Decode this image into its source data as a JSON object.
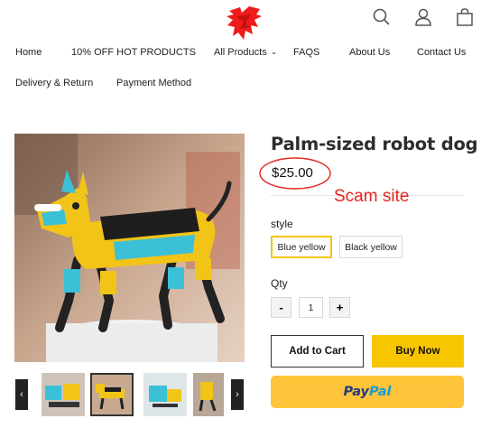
{
  "header": {
    "icons": [
      "search-icon",
      "user-icon",
      "shopping-bag-icon"
    ]
  },
  "nav": {
    "items": [
      {
        "label": "Home"
      },
      {
        "label": "10% OFF HOT PRODUCTS"
      },
      {
        "label": "All Products",
        "has_dropdown": true
      },
      {
        "label": "FAQS"
      },
      {
        "label": "About Us"
      },
      {
        "label": "Contact Us"
      },
      {
        "label": "Delivery & Return"
      },
      {
        "label": "Payment Method"
      }
    ],
    "dropdown_icon": "chevron-down-icon"
  },
  "product": {
    "title": "Palm-sized robot dog",
    "price": "$25.00",
    "style_label": "style",
    "styles": [
      {
        "label": "Blue yellow",
        "selected": true
      },
      {
        "label": "Black yellow",
        "selected": false
      }
    ],
    "qty_label": "Qty",
    "quantity": "1",
    "minus": "-",
    "plus": "+",
    "add_to_cart": "Add to Cart",
    "buy_now": "Buy Now",
    "paypal": {
      "pay": "Pay",
      "pal": "Pal"
    }
  },
  "annotation": {
    "text": "Scam site",
    "color": "#e5231d"
  },
  "gallery": {
    "prev_glyph": "‹",
    "next_glyph": "›",
    "thumbnail_count": 4,
    "active_thumbnail": 2
  },
  "colors": {
    "accent_yellow": "#f7c600",
    "paypal_yellow": "#ffc439",
    "selected_border": "#f2c416",
    "logo_red": "#ee1c1c"
  }
}
